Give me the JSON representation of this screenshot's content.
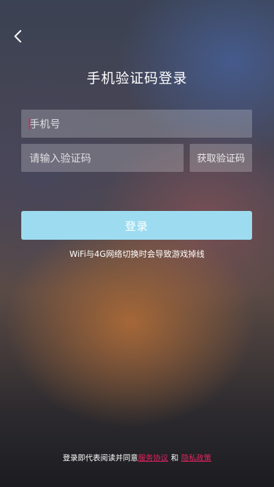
{
  "header": {
    "back_icon": "chevron-left-icon",
    "title": "手机验证码登录"
  },
  "form": {
    "phone_placeholder": "手机号",
    "code_placeholder": "请输入验证码",
    "get_code_label": "获取验证码",
    "login_label": "登录"
  },
  "notice": "WiFi与4G网络切换时会导致游戏掉线",
  "agreement": {
    "prefix": "登录即代表阅读并同意",
    "terms_label": "服务协议",
    "and": "和",
    "privacy_label": "隐私政策"
  },
  "colors": {
    "accent_link": "#e0245e",
    "login_button": "#9ddcf0"
  }
}
